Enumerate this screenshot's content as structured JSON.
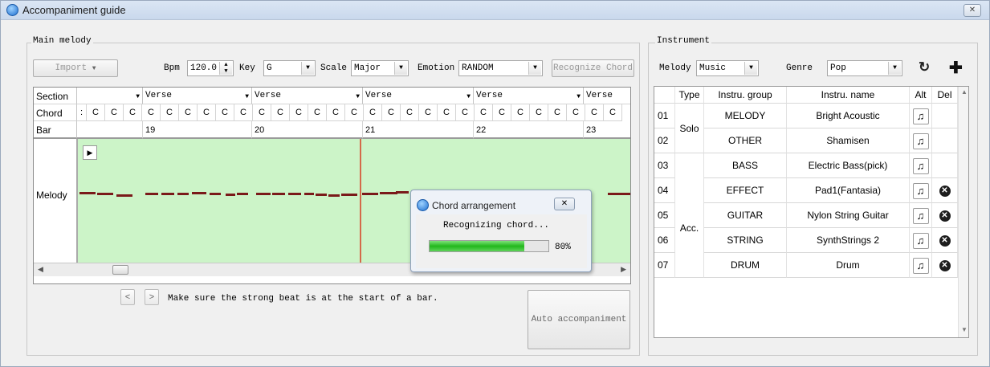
{
  "window": {
    "title": "Accompaniment guide",
    "close_label": "✕"
  },
  "main_melody": {
    "group_label": "Main melody",
    "import_label": "Import",
    "bpm_label": "Bpm",
    "bpm_value": "120.0",
    "key_label": "Key",
    "key_value": "G",
    "scale_label": "Scale",
    "scale_value": "Major",
    "emotion_label": "Emotion",
    "emotion_value": "RANDOM",
    "recognize_label": "Recognize Chord",
    "row_labels": {
      "section": "Section",
      "chord": "Chord",
      "bar": "Bar",
      "melody": "Melody"
    },
    "sections": [
      "",
      "Verse",
      "Verse",
      "Verse",
      "Verse",
      "Verse"
    ],
    "chords": [
      ":",
      "C",
      "C",
      "C",
      "C",
      "C",
      "C",
      "C",
      "C",
      "C",
      "C",
      "C",
      "C",
      "C",
      "C",
      "C",
      "C",
      "C",
      "C",
      "C",
      "C",
      "C",
      "C",
      "C",
      "C",
      "C",
      "C",
      "C",
      "C",
      "C"
    ],
    "bars": [
      "",
      "19",
      "20",
      "21",
      "22",
      "23"
    ],
    "hint": "Make sure the strong beat is at the start of a bar.",
    "auto_label": "Auto accompaniment",
    "prev_label": "<",
    "next_label": ">"
  },
  "dialog": {
    "title": "Chord arrangement",
    "close_label": "✕",
    "message": "Recognizing chord...",
    "progress": 0.8,
    "progress_label": "80%"
  },
  "instrument": {
    "group_label": "Instrument",
    "melody_label": "Melody",
    "melody_value": "Music",
    "genre_label": "Genre",
    "genre_value": "Pop",
    "headers": [
      "Type",
      "Instru. group",
      "Instru. name",
      "Alt",
      "Del"
    ],
    "type_solo": "Solo",
    "type_acc": "Acc.",
    "rows": [
      {
        "num": "01",
        "group": "MELODY",
        "name": "Bright Acoustic",
        "del": false
      },
      {
        "num": "02",
        "group": "OTHER",
        "name": "Shamisen",
        "del": false
      },
      {
        "num": "03",
        "group": "BASS",
        "name": "Electric Bass(pick)",
        "del": false
      },
      {
        "num": "04",
        "group": "EFFECT",
        "name": "Pad1(Fantasia)",
        "del": true
      },
      {
        "num": "05",
        "group": "GUITAR",
        "name": "Nylon String Guitar",
        "del": true
      },
      {
        "num": "06",
        "group": "STRING",
        "name": "SynthStrings 2",
        "del": true
      },
      {
        "num": "07",
        "group": "DRUM",
        "name": "Drum",
        "del": true
      }
    ]
  }
}
